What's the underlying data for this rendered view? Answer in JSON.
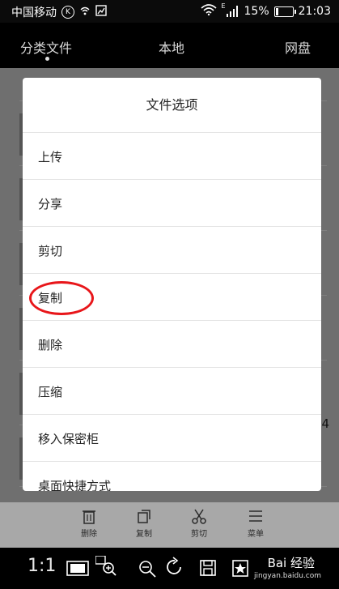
{
  "status": {
    "carrier": "中国移动",
    "k_badge": "K",
    "signal_type": "E",
    "battery": "15%",
    "battery_level": 0.15,
    "time": "21:03"
  },
  "tabs": [
    {
      "label": "分类文件",
      "active": true
    },
    {
      "label": "本地",
      "active": false
    },
    {
      "label": "网盘",
      "active": false
    }
  ],
  "background": {
    "side_number": "4"
  },
  "dialog": {
    "title": "文件选项",
    "options": [
      "上传",
      "分享",
      "剪切",
      "复制",
      "删除",
      "压缩",
      "移入保密柜",
      "桌面快捷方式"
    ],
    "highlighted_index": 3
  },
  "bottom_bar": [
    {
      "label": "删除",
      "icon": "trash-icon"
    },
    {
      "label": "复制",
      "icon": "copy-icon"
    },
    {
      "label": "剪切",
      "icon": "scissors-icon"
    },
    {
      "label": "菜单",
      "icon": "menu-icon"
    }
  ],
  "viewer": {
    "ratio": "1:1",
    "watermark": "Bai 经验",
    "watermark_sub": "jingyan.baidu.com"
  },
  "colors": {
    "annotation": "#e8161a",
    "overlay": "#6f6f6f"
  }
}
